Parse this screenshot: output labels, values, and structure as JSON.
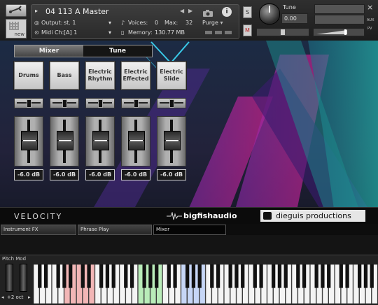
{
  "header": {
    "new_label": "new",
    "instrument_name": "04 113 A Master",
    "output_label": "Output:",
    "output_value": "st. 1",
    "midi_label": "Midi Ch:",
    "midi_value": "[A]  1",
    "voices_label": "Voices:",
    "voices_value": "0",
    "max_label": "Max:",
    "max_value": "32",
    "purge_label": "Purge",
    "memory_label": "Memory:",
    "memory_value": "130.77 MB",
    "info_glyph": "i",
    "solo_label": "S",
    "mute_label": "M",
    "tune_label": "Tune",
    "tune_value": "0.00",
    "close_glyph": "×",
    "aux_label": "AUX",
    "pv_label": "PV"
  },
  "tabs": [
    "Mixer",
    "Tune"
  ],
  "channels": [
    {
      "name": "Drums",
      "db": "-6.0 dB"
    },
    {
      "name": "Bass",
      "db": "-6.0 dB"
    },
    {
      "name": "Electric Rhythm",
      "db": "-6.0 dB"
    },
    {
      "name": "Electric Effected",
      "db": "-6.0 dB"
    },
    {
      "name": "Electric Slide",
      "db": "-6.0 dB"
    }
  ],
  "brand": {
    "velocity": "VELOCITY",
    "bigfish": "bigfishaudio",
    "dieguis": "dieguis productions"
  },
  "panel_tabs": [
    "Instrument FX",
    "Phrase Play",
    "Mixer"
  ],
  "keyboard": {
    "pitch_mod_label": "Pitch Mod",
    "octave_label": "+2 oct",
    "colors": {
      "red": "#f2b6b6",
      "green": "#b9ecb9",
      "blue": "#c6d6f6"
    }
  },
  "theme": {
    "accent_pink": "#c0218a",
    "accent_teal": "#1fa3a8",
    "accent_purple": "#7a2aa8"
  }
}
